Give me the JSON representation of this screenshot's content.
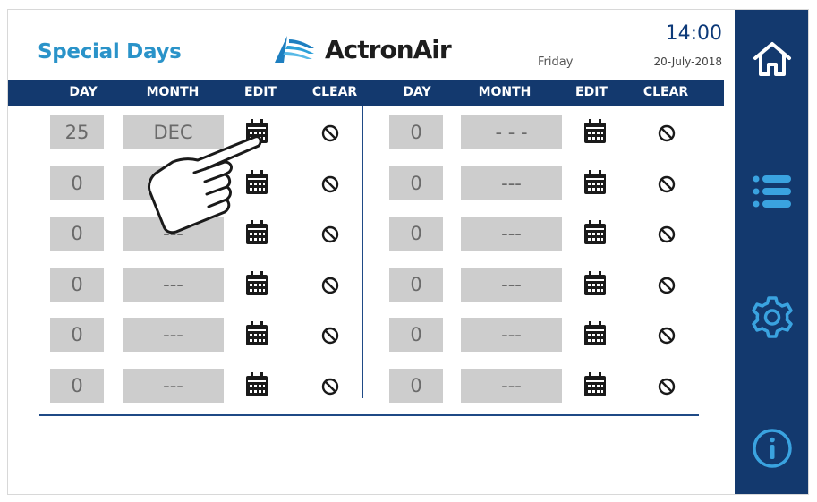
{
  "header": {
    "title": "Special Days",
    "brand": "ActronAir",
    "weekday": "Friday",
    "time": "14:00",
    "date": "20-July-2018"
  },
  "columns": {
    "left": [
      "DAY",
      "MONTH",
      "EDIT",
      "CLEAR"
    ],
    "right": [
      "DAY",
      "MONTH",
      "EDIT",
      "CLEAR"
    ]
  },
  "rows_left": [
    {
      "day": "25",
      "month": "DEC"
    },
    {
      "day": "0",
      "month": "---"
    },
    {
      "day": "0",
      "month": "---"
    },
    {
      "day": "0",
      "month": "---"
    },
    {
      "day": "0",
      "month": "---"
    },
    {
      "day": "0",
      "month": "---"
    }
  ],
  "rows_right": [
    {
      "day": "0",
      "month": "- - -"
    },
    {
      "day": "0",
      "month": "---"
    },
    {
      "day": "0",
      "month": "---"
    },
    {
      "day": "0",
      "month": "---"
    },
    {
      "day": "0",
      "month": "---"
    },
    {
      "day": "0",
      "month": "---"
    }
  ],
  "icons": {
    "edit": "calendar-icon",
    "clear": "no-entry-icon",
    "pointer": "hand-pointer-icon",
    "sidebar": [
      "home-icon",
      "menu-icon",
      "gear-icon",
      "info-icon"
    ]
  },
  "colors": {
    "navy": "#13396e",
    "title_blue": "#2a93c9",
    "cell_grey": "#cdcdcd"
  }
}
